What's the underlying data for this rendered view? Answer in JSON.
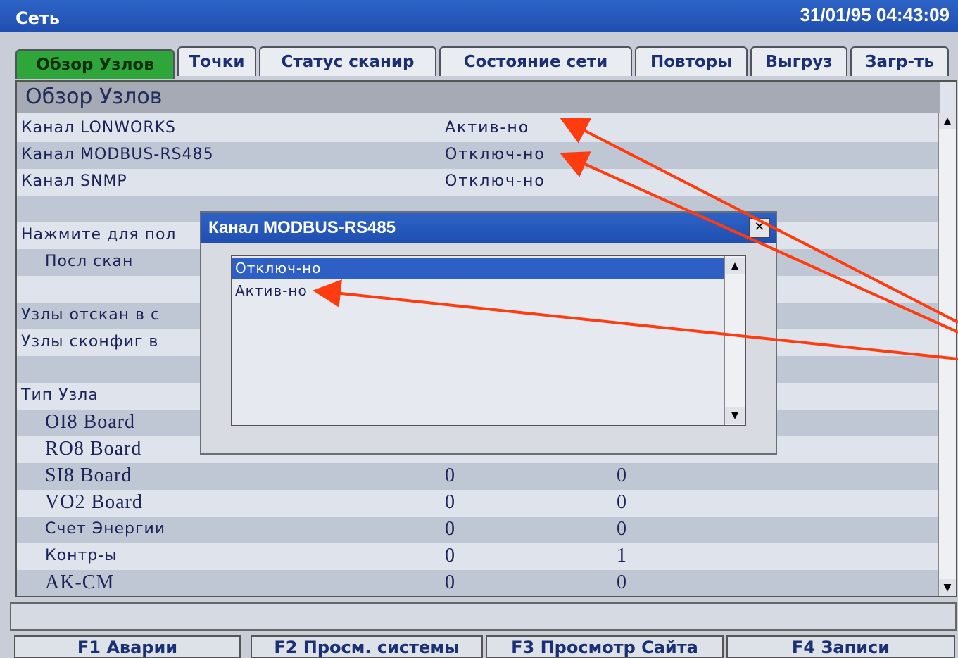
{
  "window": {
    "title": "Сеть",
    "clock": "31/01/95 04:43:09"
  },
  "tabs": [
    {
      "label": "Обзор Узлов",
      "active": true
    },
    {
      "label": "Точки",
      "active": false
    },
    {
      "label": "Статус сканир",
      "active": false
    },
    {
      "label": "Состояние сети",
      "active": false
    },
    {
      "label": "Повторы",
      "active": false
    },
    {
      "label": "Выгруз",
      "active": false
    },
    {
      "label": "Загр-ть",
      "active": false
    }
  ],
  "panel": {
    "title": "Обзор Узлов",
    "channels": [
      {
        "label": "Канал LONWORKS",
        "status": "Актив-но"
      },
      {
        "label": "Канал MODBUS-RS485",
        "status": "Отключ-но"
      },
      {
        "label": "Канал SNMP",
        "status": "Отключ-но"
      }
    ],
    "press_text": "Нажмите для пол",
    "last_scan": "Посл скан",
    "nodes_scanned": "Узлы отскан в с",
    "nodes_configured": "Узлы сконфиг в",
    "node_type_header": "Тип Узла",
    "node_types": [
      {
        "name": "OI8 Board",
        "a": "",
        "b": ""
      },
      {
        "name": "RO8 Board",
        "a": "",
        "b": ""
      },
      {
        "name": "SI8 Board",
        "a": "0",
        "b": "0"
      },
      {
        "name": "VO2 Board",
        "a": "0",
        "b": "0"
      },
      {
        "name": "Счет Энергии",
        "a": "0",
        "b": "0"
      },
      {
        "name": "Контр-ы",
        "a": "0",
        "b": "1"
      },
      {
        "name": "AK-CM",
        "a": "0",
        "b": "0"
      }
    ]
  },
  "dialog": {
    "title": "Канал MODBUS-RS485",
    "close_icon": "close-icon",
    "options": [
      {
        "label": "Отключ-но",
        "selected": true
      },
      {
        "label": "Актив-но",
        "selected": false
      }
    ]
  },
  "function_keys": [
    {
      "label": "F1 Аварии"
    },
    {
      "label": "F2 Просм. системы"
    },
    {
      "label": "F3 Просмотр Сайта"
    },
    {
      "label": "F4 Записи"
    }
  ],
  "colors": {
    "titlebar": "#2458bd",
    "active_tab": "#2fa63a",
    "selection": "#2e5fc4",
    "annotation_arrow": "#ff3b10"
  }
}
